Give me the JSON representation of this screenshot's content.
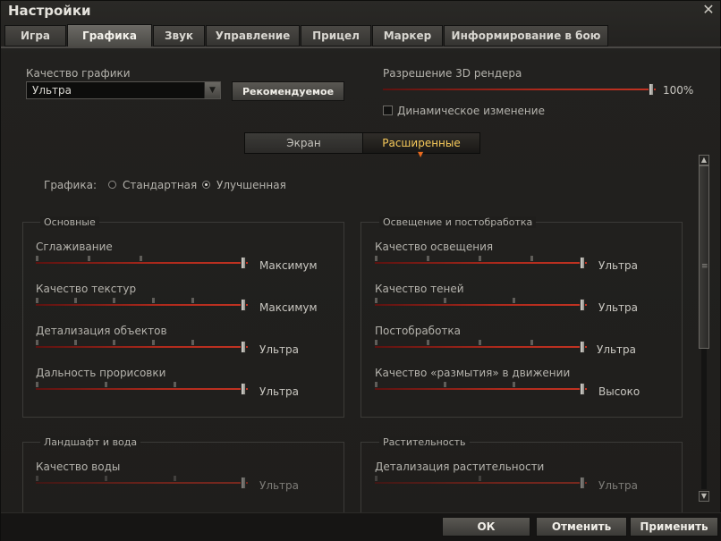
{
  "window": {
    "title": "Настройки",
    "close_glyph": "✕"
  },
  "tabs": [
    {
      "label": "Игра",
      "active": false
    },
    {
      "label": "Графика",
      "active": true
    },
    {
      "label": "Звук",
      "active": false
    },
    {
      "label": "Управление",
      "active": false
    },
    {
      "label": "Прицел",
      "active": false
    },
    {
      "label": "Маркер",
      "active": false
    },
    {
      "label": "Информирование в бою",
      "active": false
    }
  ],
  "top": {
    "quality_label": "Качество графики",
    "quality_value": "Ультра",
    "recommended_button": "Рекомендуемое",
    "render_label": "Разрешение 3D рендера",
    "render_value": "100%",
    "render_level": 1.0,
    "dynamic_label": "Динамическое изменение",
    "dynamic_checked": false
  },
  "subtabs": {
    "screen": "Экран",
    "advanced": "Расширенные",
    "active": "advanced"
  },
  "graphics_mode": {
    "label": "Графика:",
    "standard": "Стандартная",
    "improved": "Улучшенная",
    "selected": "improved"
  },
  "groups": {
    "basic": {
      "title": "Основные",
      "items": [
        {
          "label": "Сглаживание",
          "value": "Максимум"
        },
        {
          "label": "Качество текстур",
          "value": "Максимум"
        },
        {
          "label": "Детализация объектов",
          "value": "Ультра"
        },
        {
          "label": "Дальность прорисовки",
          "value": "Ультра"
        }
      ]
    },
    "lighting": {
      "title": "Освещение и постобработка",
      "items": [
        {
          "label": "Качество освещения",
          "value": "Ультра"
        },
        {
          "label": "Качество теней",
          "value": "Ультра"
        },
        {
          "label": "Постобработка",
          "value": "Ультра"
        },
        {
          "label": "Качество «размытия» в движении",
          "value": "Высоко"
        }
      ]
    },
    "landscape": {
      "title": "Ландшафт и вода",
      "items": [
        {
          "label": "Качество воды",
          "value": "Ультра"
        }
      ]
    },
    "vegetation": {
      "title": "Растительность",
      "items": [
        {
          "label": "Детализация растительности",
          "value": "Ультра"
        }
      ]
    }
  },
  "footer": {
    "ok": "ОК",
    "cancel": "Отменить",
    "apply": "Применить"
  },
  "colors": {
    "accent_slider": "#b02a1c",
    "active_subtab_text": "#f7c95a"
  }
}
